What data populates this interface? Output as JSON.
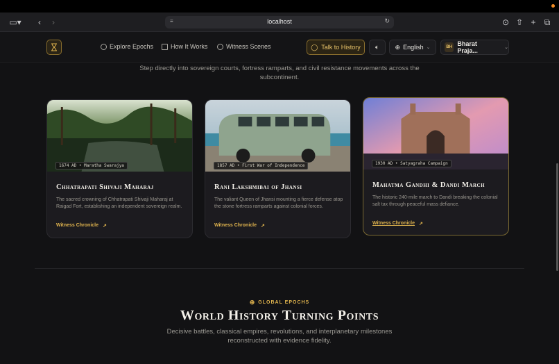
{
  "browser": {
    "url": "localhost"
  },
  "nav": {
    "logo_icon": "hourglass-icon",
    "links": [
      {
        "label": "Explore Epochs",
        "icon": "compass-icon"
      },
      {
        "label": "How It Works",
        "icon": "book-icon"
      },
      {
        "label": "Witness Scenes",
        "icon": "clock-icon"
      }
    ],
    "talk_label": "Talk to History",
    "language": "English",
    "user_initials": "BH",
    "user_name": "Bharat Praja..."
  },
  "intro_text": "Step directly into sovereign courts, fortress ramparts, and civil resistance movements across the subcontinent.",
  "cards": [
    {
      "tag": "1674 AD • Maratha Swarajya",
      "title": "Chhatrapati Shivaji Maharaj",
      "description": "The sacred crowning of Chhatrapati Shivaji Maharaj at Raigad Fort, establishing an independent sovereign realm.",
      "link": "Witness Chronicle"
    },
    {
      "tag": "1857 AD • First War of Independence",
      "title": "Rani Lakshmibai of Jhansi",
      "description": "The valiant Queen of Jhansi mounting a fierce defense atop the stone fortress ramparts against colonial forces.",
      "link": "Witness Chronicle"
    },
    {
      "tag": "1930 AD • Satyagraha Campaign",
      "title": "Mahatma Gandhi & Dandi March",
      "description": "The historic 240-mile march to Dandi breaking the colonial salt tax through peaceful mass defiance.",
      "link": "Witness Chronicle"
    }
  ],
  "section": {
    "eyebrow": "GLOBAL EPOCHS",
    "title": "World History Turning Points",
    "description": "Decisive battles, classical empires, revolutions, and interplanetary milestones reconstructed with evidence fidelity."
  },
  "colors": {
    "accent": "#e0b44e",
    "background": "#121214",
    "card": "#1c1b1f"
  }
}
